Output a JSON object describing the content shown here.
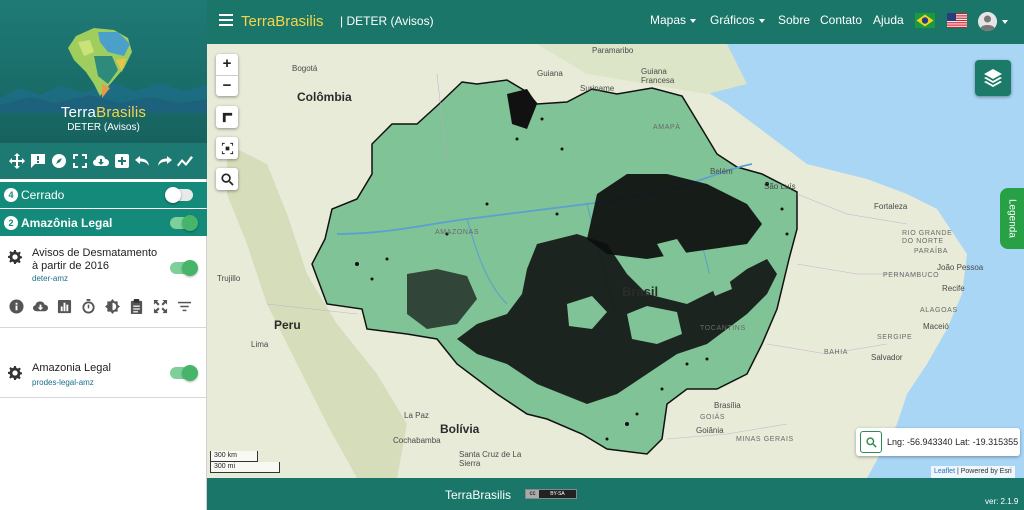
{
  "sidebar": {
    "brand_part1": "Terra",
    "brand_part2": "Brasilis",
    "brand_sub": "DETER (Avisos)",
    "toolbar_icons": [
      "move-icon",
      "comment-icon",
      "compass-icon",
      "fullscreen-icon",
      "cloud-download-icon",
      "add-layer-icon",
      "undo-icon",
      "redo-icon",
      "chart-line-icon"
    ],
    "groups": [
      {
        "number": "4",
        "label": "Cerrado",
        "enabled": false
      },
      {
        "number": "2",
        "label": "Amazônia Legal",
        "enabled": true
      }
    ],
    "layers": [
      {
        "title": "Avisos de Desmatamento à partir de 2016",
        "subtitle": "deter-amz",
        "enabled": true
      },
      {
        "title": "Amazonia Legal",
        "subtitle": "prodes-legal-amz",
        "enabled": true
      }
    ],
    "layer_tools": [
      "info-icon",
      "cloud-download-icon",
      "bar-chart-icon",
      "timer-icon",
      "contrast-icon",
      "clipboard-icon",
      "fullscreen-icon",
      "filter-icon"
    ]
  },
  "topbar": {
    "brand_part1": "Terra",
    "brand_part2": "Brasilis",
    "subtitle": "| DETER (Avisos)",
    "nav": [
      "Mapas",
      "Gráficos",
      "Sobre",
      "Contato",
      "Ajuda"
    ],
    "flags": [
      "brazil-flag",
      "usa-flag"
    ]
  },
  "map": {
    "zoom_in": "+",
    "zoom_out": "−",
    "legend_tab": "Legenda",
    "scale_km": "300 km",
    "scale_mi": "300 mi",
    "lng_label": "Lng: -56.943340",
    "lat_label": "Lat: -19.315355",
    "attribution_link": "Leaflet",
    "attribution_text": "| Powered by Esri",
    "labels": {
      "colombia": "Colômbia",
      "peru": "Peru",
      "bolivia": "Bolívia",
      "brasil": "Brasil",
      "amazonas": "AMAZONAS",
      "tocantins": "TOCANTINS",
      "bahia": "BAHIA",
      "minas": "MINAS GERAIS",
      "amapa": "AMAPÁ",
      "paramaribo": "Paramaribo",
      "guiana": "Guiana",
      "guiana_francesa": "Guiana\nFrancesa",
      "suriname": "Suriname",
      "bogota": "Bogotá",
      "lima": "Lima",
      "la_paz": "La Paz",
      "cochabamba": "Cochabamba",
      "santa_cruz": "Santa Cruz\nde La Sierra",
      "brasilia": "Brasília",
      "salvador": "Salvador",
      "fortaleza": "Fortaleza",
      "sao_luis": "São Luís",
      "joao_pessoa": "João Pessoa",
      "recife": "Recife",
      "maceio": "Maceió",
      "trujillo": "Trujillo",
      "goiania": "Goiânia",
      "belem": "Belém",
      "rio_grande": "RIO GRANDE\nDO NORTE",
      "paraiba": "PARAÍBA",
      "pernambuco": "PERNAMBUCO",
      "alagoas": "ALAGOAS",
      "sergipe": "SERGIPE",
      "goias": "GOIÁS"
    }
  },
  "footer": {
    "brand": "TerraBrasilis",
    "license": "BY-SA",
    "version": "ver: 2.1.9"
  }
}
